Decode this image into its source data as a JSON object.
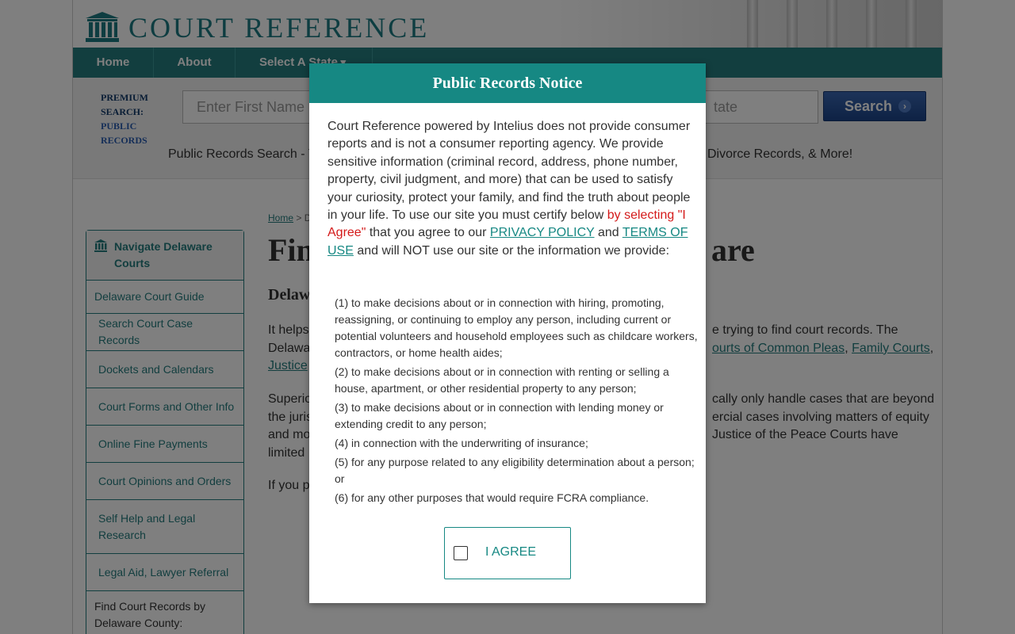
{
  "site": {
    "logo_text": "COURT REFERENCE"
  },
  "nav": {
    "items": [
      {
        "label": "Home"
      },
      {
        "label": "About"
      },
      {
        "label": "Select A State"
      }
    ]
  },
  "search": {
    "premium_label": "PREMIUM SEARCH:",
    "premium_sub": "PUBLIC RECORDS",
    "first_name_placeholder": "Enter First Name",
    "state_placeholder": "tate",
    "button_label": "Search",
    "button_icon": "chevron-right-icon",
    "tagline_left": "Public Records Search - Y",
    "tagline_right": "Divorce Records, & More!"
  },
  "sidebar": {
    "title": "Navigate Delaware Courts",
    "icon": "courthouse-icon",
    "items": [
      {
        "label": "Delaware Court Guide"
      },
      {
        "label": "Search Court Case Records"
      },
      {
        "label": "Dockets and Calendars"
      },
      {
        "label": "Court Forms and Other Info"
      },
      {
        "label": "Online Fine Payments"
      },
      {
        "label": "Court Opinions and Orders"
      },
      {
        "label": "Self Help and Legal Research"
      },
      {
        "label": "Legal Aid, Lawyer Referral"
      },
      {
        "label": "Find Court Records by Delaware County:"
      }
    ]
  },
  "content": {
    "breadcrumb_home": "Home",
    "breadcrumb_sep": " > D",
    "title_left": "Fin",
    "title_right": "are",
    "subtitle": "Delaw",
    "p1_left_1": "It helps",
    "p1_left_2": "Delawa",
    "p1_left_3": "Justice",
    "p1_right_1": "e trying to find court records. The",
    "p1_link_common": "ourts of Common Pleas",
    "p1_sep": ", ",
    "p1_link_family": "Family Courts",
    "p1_end": ",",
    "p2_left_1": "Superio",
    "p2_left_2": "the juris",
    "p2_left_3": "and mo",
    "p2_left_4": "limited",
    "p2_right_1": "cally only handle cases that are beyond",
    "p2_right_2": "ercial cases involving matters of equity",
    "p2_right_3": "Justice of the Peace Courts have",
    "p3_left": "If you p"
  },
  "modal": {
    "title": "Public Records Notice",
    "intro_1": "Court Reference powered by Intelius does not provide consumer reports and is not a consumer reporting agency. We provide sensitive information (criminal record, address, phone number, property, civil judgment, and more) that can be used to satisfy your curiosity, protect your family, and find the truth about people in your life. To use our site you must certify below ",
    "intro_red": "by selecting \"I Agree\"",
    "intro_2": " that you agree to our ",
    "privacy_link": "PRIVACY POLICY",
    "intro_3": " and ",
    "terms_link": "TERMS OF USE",
    "intro_4": " and will NOT use our site or the information we provide:",
    "list": [
      "(1) to make decisions about or in connection with hiring, promoting, reassigning, or continuing to employ any person, including current or potential volunteers and household employees such as childcare workers, contractors, or home health aides;",
      "(2) to make decisions about or in connection with renting or selling a house, apartment, or other residential property to any person;",
      "(3) to make decisions about or in connection with lending money or extending credit to any person;",
      "(4) in connection with the underwriting of insurance;",
      "(5) for any purpose related to any eligibility determination about a person; or",
      "(6) for any other purposes that would require FCRA compliance."
    ],
    "agree_label": "I AGREE"
  }
}
